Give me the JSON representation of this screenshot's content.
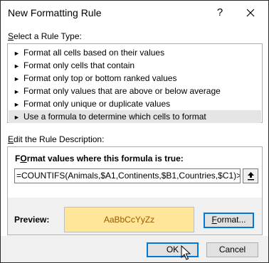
{
  "dialog": {
    "title": "New Formatting Rule",
    "help_label": "?",
    "close_icon": "close-icon"
  },
  "rule_type": {
    "section_label_ul": "S",
    "section_label_rest": "elect a Rule Type:",
    "items": [
      {
        "label": "Format all cells based on their values",
        "selected": false
      },
      {
        "label": "Format only cells that contain",
        "selected": false
      },
      {
        "label": "Format only top or bottom ranked values",
        "selected": false
      },
      {
        "label": "Format only values that are above or below average",
        "selected": false
      },
      {
        "label": "Format only unique or duplicate values",
        "selected": false
      },
      {
        "label": "Use a formula to determine which cells to format",
        "selected": true
      }
    ],
    "arrow_glyph": "►"
  },
  "description": {
    "section_label_ul": "E",
    "section_label_rest": "dit the Rule Description:",
    "formula_label_ul": "O",
    "formula_label_pre": "F",
    "formula_label_rest": "rmat values where this formula is true:",
    "formula_value": "=COUNTIFS(Animals,$A1,Continents,$B1,Countries,$C1)>1",
    "collapse_icon": "collapse-dialog-icon",
    "preview_label": "Preview:",
    "preview_text": "AaBbCcYyZz",
    "preview_fill": "#ffe699",
    "preview_font_color": "#9c5700",
    "format_button_ul": "F",
    "format_button_rest": "ormat..."
  },
  "footer": {
    "ok_label": "OK",
    "cancel_label": "Cancel"
  }
}
